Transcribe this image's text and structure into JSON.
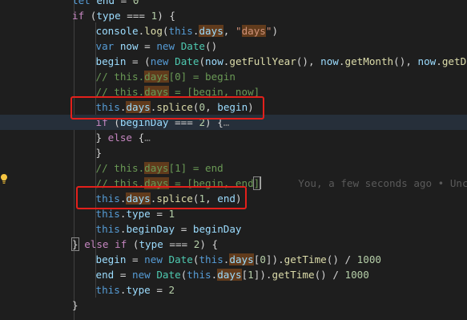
{
  "colors": {
    "background": "#1e1e1e",
    "keyword": "#569cd6",
    "control": "#c586c0",
    "function": "#dcdcaa",
    "variable": "#9cdcfe",
    "class": "#4ec9b0",
    "string": "#ce9178",
    "number": "#b5cea8",
    "comment": "#6a9955",
    "highlight": "#613b1c",
    "annotation_box": "#e3201b"
  },
  "editor": {
    "lightbulb_icon": "lightbulb-icon",
    "lines": [
      {
        "indent": 0,
        "tokens": [
          {
            "t": "let",
            "c": "kw"
          },
          {
            "t": " "
          },
          {
            "t": "end",
            "c": "var"
          },
          {
            "t": " = "
          },
          {
            "t": "0",
            "c": "num"
          }
        ]
      },
      {
        "indent": 0,
        "tokens": [
          {
            "t": "if",
            "c": "ctl"
          },
          {
            "t": " ("
          },
          {
            "t": "type",
            "c": "var"
          },
          {
            "t": " === "
          },
          {
            "t": "1",
            "c": "num"
          },
          {
            "t": ") {"
          }
        ]
      },
      {
        "indent": 1,
        "tokens": [
          {
            "t": "console",
            "c": "var"
          },
          {
            "t": "."
          },
          {
            "t": "log",
            "c": "fn"
          },
          {
            "t": "("
          },
          {
            "t": "this",
            "c": "kw"
          },
          {
            "t": "."
          },
          {
            "t": "days",
            "c": "var",
            "hl": true
          },
          {
            "t": ", "
          },
          {
            "t": "\"",
            "c": "str"
          },
          {
            "t": "days",
            "c": "str",
            "hl": true
          },
          {
            "t": "\"",
            "c": "str"
          },
          {
            "t": ")"
          }
        ]
      },
      {
        "indent": 1,
        "tokens": [
          {
            "t": "var",
            "c": "kw"
          },
          {
            "t": " "
          },
          {
            "t": "now",
            "c": "var"
          },
          {
            "t": " = "
          },
          {
            "t": "new",
            "c": "kw"
          },
          {
            "t": " "
          },
          {
            "t": "Date",
            "c": "cls"
          },
          {
            "t": "()"
          }
        ]
      },
      {
        "indent": 1,
        "tokens": [
          {
            "t": "begin",
            "c": "var"
          },
          {
            "t": " = ("
          },
          {
            "t": "new",
            "c": "kw"
          },
          {
            "t": " "
          },
          {
            "t": "Date",
            "c": "cls"
          },
          {
            "t": "("
          },
          {
            "t": "now",
            "c": "var"
          },
          {
            "t": "."
          },
          {
            "t": "getFullYear",
            "c": "fn"
          },
          {
            "t": "(), "
          },
          {
            "t": "now",
            "c": "var"
          },
          {
            "t": "."
          },
          {
            "t": "getMonth",
            "c": "fn"
          },
          {
            "t": "(), "
          },
          {
            "t": "now",
            "c": "var"
          },
          {
            "t": "."
          },
          {
            "t": "getD",
            "c": "fn"
          }
        ]
      },
      {
        "indent": 1,
        "tokens": [
          {
            "t": "// this.",
            "c": "com"
          },
          {
            "t": "days",
            "c": "com",
            "hl": true
          },
          {
            "t": "[0] = begin",
            "c": "com"
          }
        ]
      },
      {
        "indent": 1,
        "tokens": [
          {
            "t": "// this.",
            "c": "com"
          },
          {
            "t": "days",
            "c": "com",
            "hl": true
          },
          {
            "t": " = [begin, now]",
            "c": "com"
          }
        ]
      },
      {
        "indent": 1,
        "tokens": [
          {
            "t": "this",
            "c": "kw"
          },
          {
            "t": "."
          },
          {
            "t": "days",
            "c": "var",
            "hl": true
          },
          {
            "t": "."
          },
          {
            "t": "splice",
            "c": "fn"
          },
          {
            "t": "("
          },
          {
            "t": "0",
            "c": "num"
          },
          {
            "t": ", "
          },
          {
            "t": "begin",
            "c": "var"
          },
          {
            "t": ")"
          }
        ]
      },
      {
        "indent": 1,
        "current": true,
        "tokens": [
          {
            "t": "if",
            "c": "ctl"
          },
          {
            "t": " ("
          },
          {
            "t": "beginDay",
            "c": "var"
          },
          {
            "t": " === "
          },
          {
            "t": "2",
            "c": "num"
          },
          {
            "t": ") {"
          },
          {
            "t": "…",
            "c": "fold"
          }
        ]
      },
      {
        "indent": 1,
        "tokens": [
          {
            "t": "} "
          },
          {
            "t": "else",
            "c": "ctl"
          },
          {
            "t": " {"
          },
          {
            "t": "…",
            "c": "fold"
          }
        ]
      },
      {
        "indent": 1,
        "tokens": [
          {
            "t": "}"
          }
        ]
      },
      {
        "indent": 1,
        "tokens": [
          {
            "t": "// this.",
            "c": "com"
          },
          {
            "t": "days",
            "c": "com",
            "hl": true
          },
          {
            "t": "[1] = end",
            "c": "com"
          }
        ]
      },
      {
        "indent": 1,
        "cursor": true,
        "tokens": [
          {
            "t": "// this.",
            "c": "com"
          },
          {
            "t": "days",
            "c": "com",
            "hl": true
          },
          {
            "t": " = [begin, end",
            "c": "com"
          },
          {
            "t": "]",
            "c": "com",
            "brk": true
          }
        ],
        "blame": "You, a few seconds ago • Unc"
      },
      {
        "indent": 1,
        "tokens": [
          {
            "t": "this",
            "c": "kw"
          },
          {
            "t": "."
          },
          {
            "t": "days",
            "c": "var",
            "hl": true
          },
          {
            "t": "."
          },
          {
            "t": "splice",
            "c": "fn"
          },
          {
            "t": "("
          },
          {
            "t": "1",
            "c": "num"
          },
          {
            "t": ", "
          },
          {
            "t": "end",
            "c": "var"
          },
          {
            "t": ")"
          }
        ]
      },
      {
        "indent": 1,
        "tokens": [
          {
            "t": "this",
            "c": "kw"
          },
          {
            "t": "."
          },
          {
            "t": "type",
            "c": "var"
          },
          {
            "t": " = "
          },
          {
            "t": "1",
            "c": "num"
          }
        ]
      },
      {
        "indent": 1,
        "tokens": [
          {
            "t": "this",
            "c": "kw"
          },
          {
            "t": "."
          },
          {
            "t": "beginDay",
            "c": "var"
          },
          {
            "t": " = "
          },
          {
            "t": "beginDay",
            "c": "var"
          }
        ]
      },
      {
        "indent": 0,
        "tokens": [
          {
            "t": "}",
            "brk": true
          },
          {
            "t": " "
          },
          {
            "t": "else",
            "c": "ctl"
          },
          {
            "t": " "
          },
          {
            "t": "if",
            "c": "ctl"
          },
          {
            "t": " ("
          },
          {
            "t": "type",
            "c": "var"
          },
          {
            "t": " === "
          },
          {
            "t": "2",
            "c": "num"
          },
          {
            "t": ") {"
          }
        ]
      },
      {
        "indent": 1,
        "tokens": [
          {
            "t": "begin",
            "c": "var"
          },
          {
            "t": " = "
          },
          {
            "t": "new",
            "c": "kw"
          },
          {
            "t": " "
          },
          {
            "t": "Date",
            "c": "cls"
          },
          {
            "t": "("
          },
          {
            "t": "this",
            "c": "kw"
          },
          {
            "t": "."
          },
          {
            "t": "days",
            "c": "var",
            "hl": true
          },
          {
            "t": "["
          },
          {
            "t": "0",
            "c": "num"
          },
          {
            "t": "])."
          },
          {
            "t": "getTime",
            "c": "fn"
          },
          {
            "t": "() / "
          },
          {
            "t": "1000",
            "c": "num"
          }
        ]
      },
      {
        "indent": 1,
        "tokens": [
          {
            "t": "end",
            "c": "var"
          },
          {
            "t": " = "
          },
          {
            "t": "new",
            "c": "kw"
          },
          {
            "t": " "
          },
          {
            "t": "Date",
            "c": "cls"
          },
          {
            "t": "("
          },
          {
            "t": "this",
            "c": "kw"
          },
          {
            "t": "."
          },
          {
            "t": "days",
            "c": "var",
            "hl": true
          },
          {
            "t": "["
          },
          {
            "t": "1",
            "c": "num"
          },
          {
            "t": "])."
          },
          {
            "t": "getTime",
            "c": "fn"
          },
          {
            "t": "() / "
          },
          {
            "t": "1000",
            "c": "num"
          }
        ]
      },
      {
        "indent": 1,
        "tokens": [
          {
            "t": "this",
            "c": "kw"
          },
          {
            "t": "."
          },
          {
            "t": "type",
            "c": "var"
          },
          {
            "t": " = "
          },
          {
            "t": "2",
            "c": "num"
          }
        ]
      },
      {
        "indent": 0,
        "tokens": [
          {
            "t": "}"
          }
        ]
      }
    ]
  }
}
